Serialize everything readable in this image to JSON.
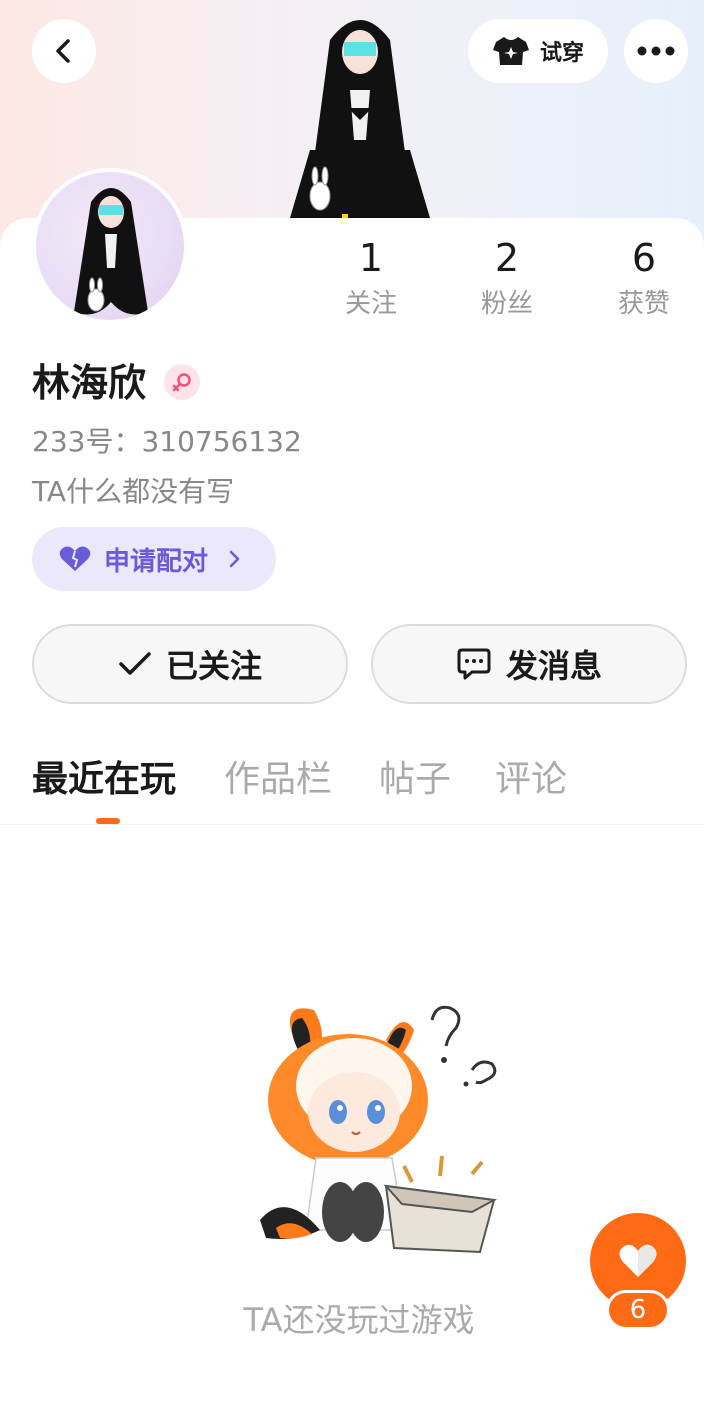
{
  "header": {
    "tryon_label": "试穿",
    "icons": [
      "back-arrow-icon",
      "tshirt-icon",
      "more-dots-icon"
    ]
  },
  "profile": {
    "username": "林海欣",
    "gender_icon": "female-icon",
    "user_id": "233号：310756132",
    "bio": "TA什么都没有写"
  },
  "stats": [
    {
      "value": "1",
      "label": "关注"
    },
    {
      "value": "2",
      "label": "粉丝"
    },
    {
      "value": "6",
      "label": "获赞"
    }
  ],
  "pair": {
    "label": "申请配对",
    "icon": "heart-icon"
  },
  "actions": {
    "follow_label": "已关注",
    "message_label": "发消息"
  },
  "tabs": [
    {
      "label": "最近在玩",
      "active": true
    },
    {
      "label": "作品栏",
      "active": false
    },
    {
      "label": "帖子",
      "active": false
    },
    {
      "label": "评论",
      "active": false
    }
  ],
  "empty_state": {
    "text": "TA还没玩过游戏"
  },
  "like_fab": {
    "count": "6"
  },
  "colors": {
    "accent": "#ff6a14",
    "pair_bg": "#ece8fb",
    "pair_text": "#6a5cd8",
    "gender_badge": "#fde4ea"
  }
}
